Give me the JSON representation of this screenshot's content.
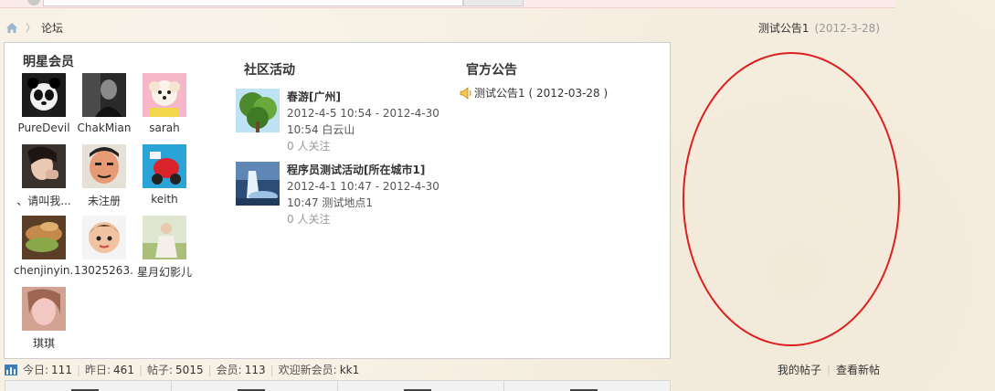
{
  "breadcrumb": {
    "home_icon": "home-icon",
    "current": "论坛"
  },
  "top_notice": {
    "title": "测试公告1",
    "date": "(2012-3-28)"
  },
  "stars": {
    "heading": "明星会员",
    "members": [
      {
        "name": "PureDevil",
        "avatar": "panda-avatar"
      },
      {
        "name": "ChakMian",
        "avatar": "dark-portrait-avatar"
      },
      {
        "name": "sarah",
        "avatar": "white-dog-avatar"
      },
      {
        "name": "、请叫我...",
        "avatar": "girl-avatar"
      },
      {
        "name": "未注册",
        "avatar": "cartoon-face-avatar"
      },
      {
        "name": "keith",
        "avatar": "red-toy-avatar"
      },
      {
        "name": "chenjinyin...",
        "avatar": "food-avatar"
      },
      {
        "name": "13025263...",
        "avatar": "cartoon-boy-avatar"
      },
      {
        "name": "星月幻影儿",
        "avatar": "girl-field-avatar"
      },
      {
        "name": "琪琪",
        "avatar": "pink-girl-avatar"
      }
    ]
  },
  "activities": {
    "heading": "社区活动",
    "items": [
      {
        "title": "春游[广州]",
        "time": "2012-4-5 10:54 - 2012-4-30 10:54 白云山",
        "follow": "0 人关注",
        "image": "tree-photo"
      },
      {
        "title": "程序员测试活动[所在城市1]",
        "time": "2012-4-1 10:47 - 2012-4-30 10:47 测试地点1",
        "follow": "0 人关注",
        "image": "waterfall-photo"
      }
    ]
  },
  "announcements": {
    "heading": "官方公告",
    "items": [
      {
        "text": "测试公告1 ( 2012-03-28 )",
        "icon": "speaker-icon"
      }
    ]
  },
  "stats": {
    "today_label": "今日:",
    "today": "111",
    "yesterday_label": "昨日:",
    "yesterday": "461",
    "posts_label": "帖子:",
    "posts": "5015",
    "members_label": "会员:",
    "members": "113",
    "newest_label": "欢迎新会员:",
    "newest": "kk1"
  },
  "links": {
    "my_posts": "我的帖子",
    "new_posts": "查看新帖"
  },
  "colors": {
    "annotation": "#dd1f1f",
    "page_bg": "#f6efe2",
    "panel_border": "#cdcdcd"
  }
}
